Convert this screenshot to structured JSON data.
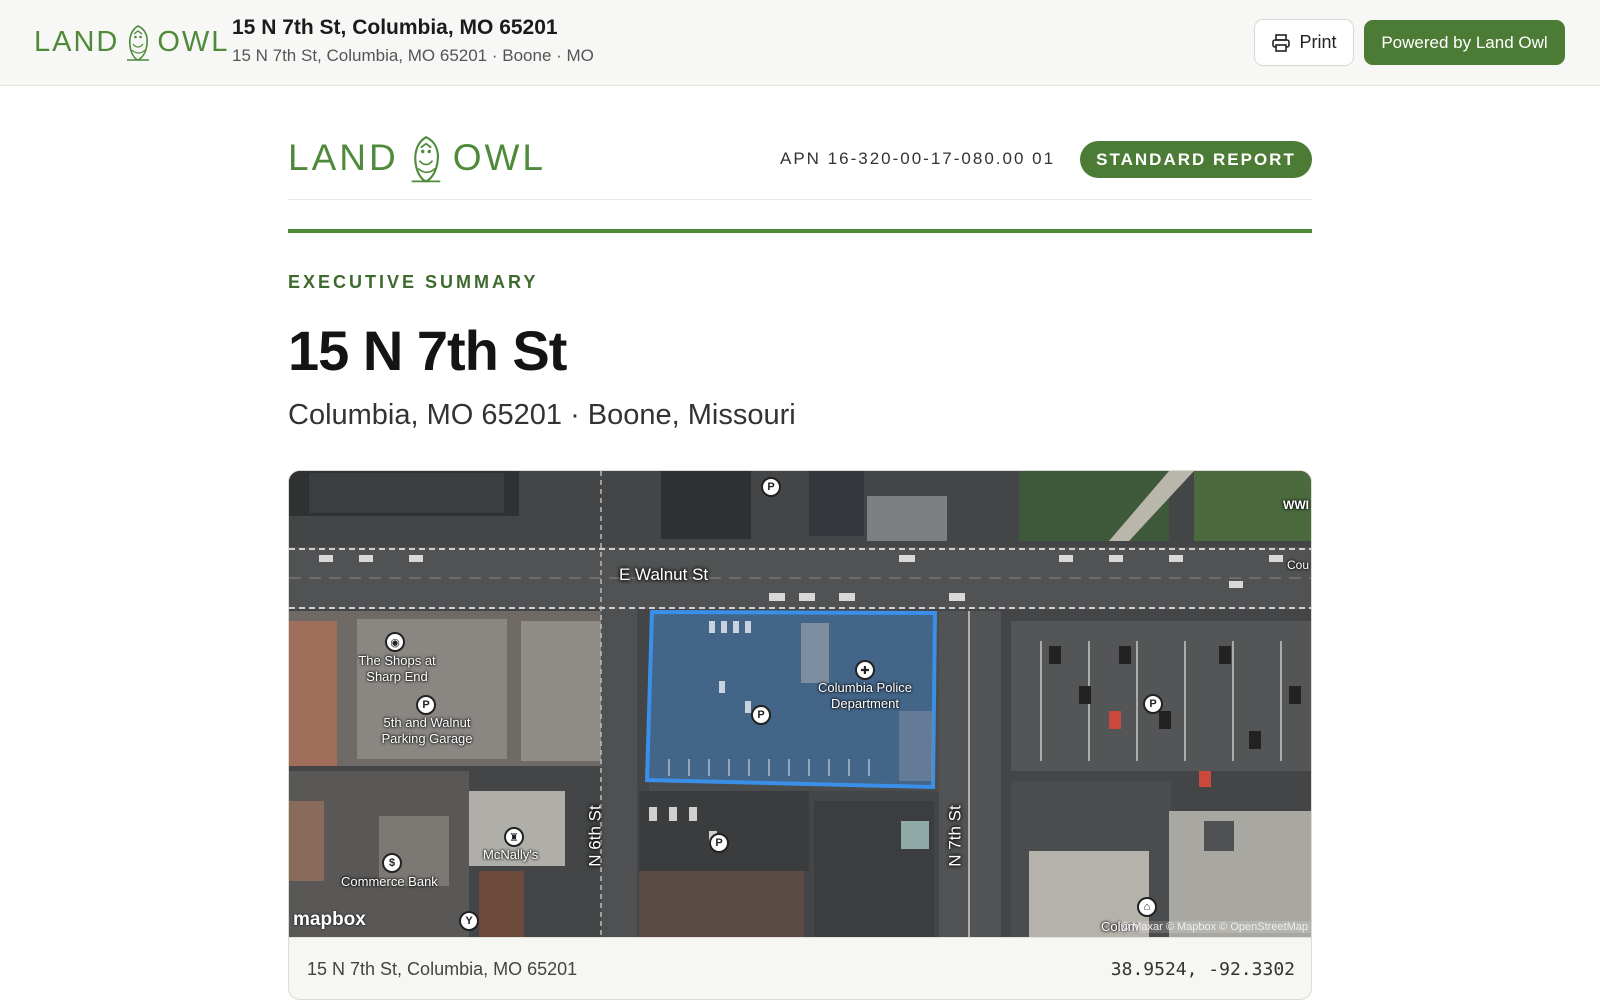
{
  "header": {
    "brand_left": "LAND",
    "brand_right": "OWL",
    "title": "15 N 7th St, Columbia, MO 65201",
    "subtitle": "15 N 7th St, Columbia, MO 65201 · Boone · MO",
    "print_label": "Print",
    "powered_label": "Powered by Land Owl"
  },
  "report": {
    "brand_left": "LAND",
    "brand_right": "OWL",
    "apn": "APN 16-320-00-17-080.00 01",
    "badge": "STANDARD REPORT",
    "eyebrow": "EXECUTIVE SUMMARY",
    "heading": "15 N 7th St",
    "subheading": "Columbia, MO 65201 · Boone, Missouri"
  },
  "map": {
    "streets": {
      "walnut": "E Walnut St",
      "sixth": "N 6th St",
      "seventh": "N 7th St"
    },
    "pois": {
      "shops": "The Shops at Sharp End",
      "garage": "5th and Walnut Parking Garage",
      "police": "Columbia Police Department",
      "mcnallys": "McNally's",
      "commerce": "Commerce Bank",
      "wwi": "WWI",
      "cou": "Cou",
      "colum": "Colum"
    },
    "pin_letter": "P",
    "logo": "mapbox",
    "attribution": "© Maxar © Mapbox © OpenStreetMap",
    "footer_address": "15 N 7th St, Columbia, MO 65201",
    "footer_coords": "38.9524, -92.3302",
    "colors": {
      "parcel": "#3a8fe8",
      "brand": "#4f8a3a",
      "button": "#4b7b35"
    }
  }
}
